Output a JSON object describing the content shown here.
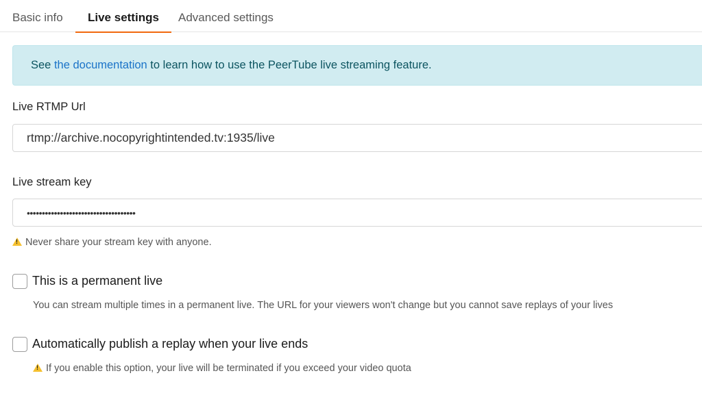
{
  "tabs": {
    "basic_info": "Basic info",
    "live_settings": "Live settings",
    "advanced_settings": "Advanced settings",
    "active": "Live settings"
  },
  "alert": {
    "prefix": "See ",
    "link": "the documentation",
    "suffix": " to learn how to use the PeerTube live streaming feature."
  },
  "rtmp": {
    "label": "Live RTMP Url",
    "value": "rtmp://archive.nocopyrightintended.tv:1935/live"
  },
  "stream_key": {
    "label": "Live stream key",
    "masked_value": "••••••••••••••••••••••••••••••••••••",
    "warning": "Never share your stream key with anyone."
  },
  "permanent_live": {
    "label": "This is a permanent live",
    "checked": false,
    "hint": "You can stream multiple times in a permanent live. The URL for your viewers won't change but you cannot save replays of your lives"
  },
  "auto_replay": {
    "label": "Automatically publish a replay when your live ends",
    "checked": false,
    "hint": "If you enable this option, your live will be terminated if you exceed your video quota"
  },
  "colors": {
    "accent": "#f1680d",
    "alert_bg": "#d1ecf1",
    "link": "#1a73c8",
    "warning": "#f5c02e"
  },
  "icons": {
    "warning": "warning-icon"
  }
}
